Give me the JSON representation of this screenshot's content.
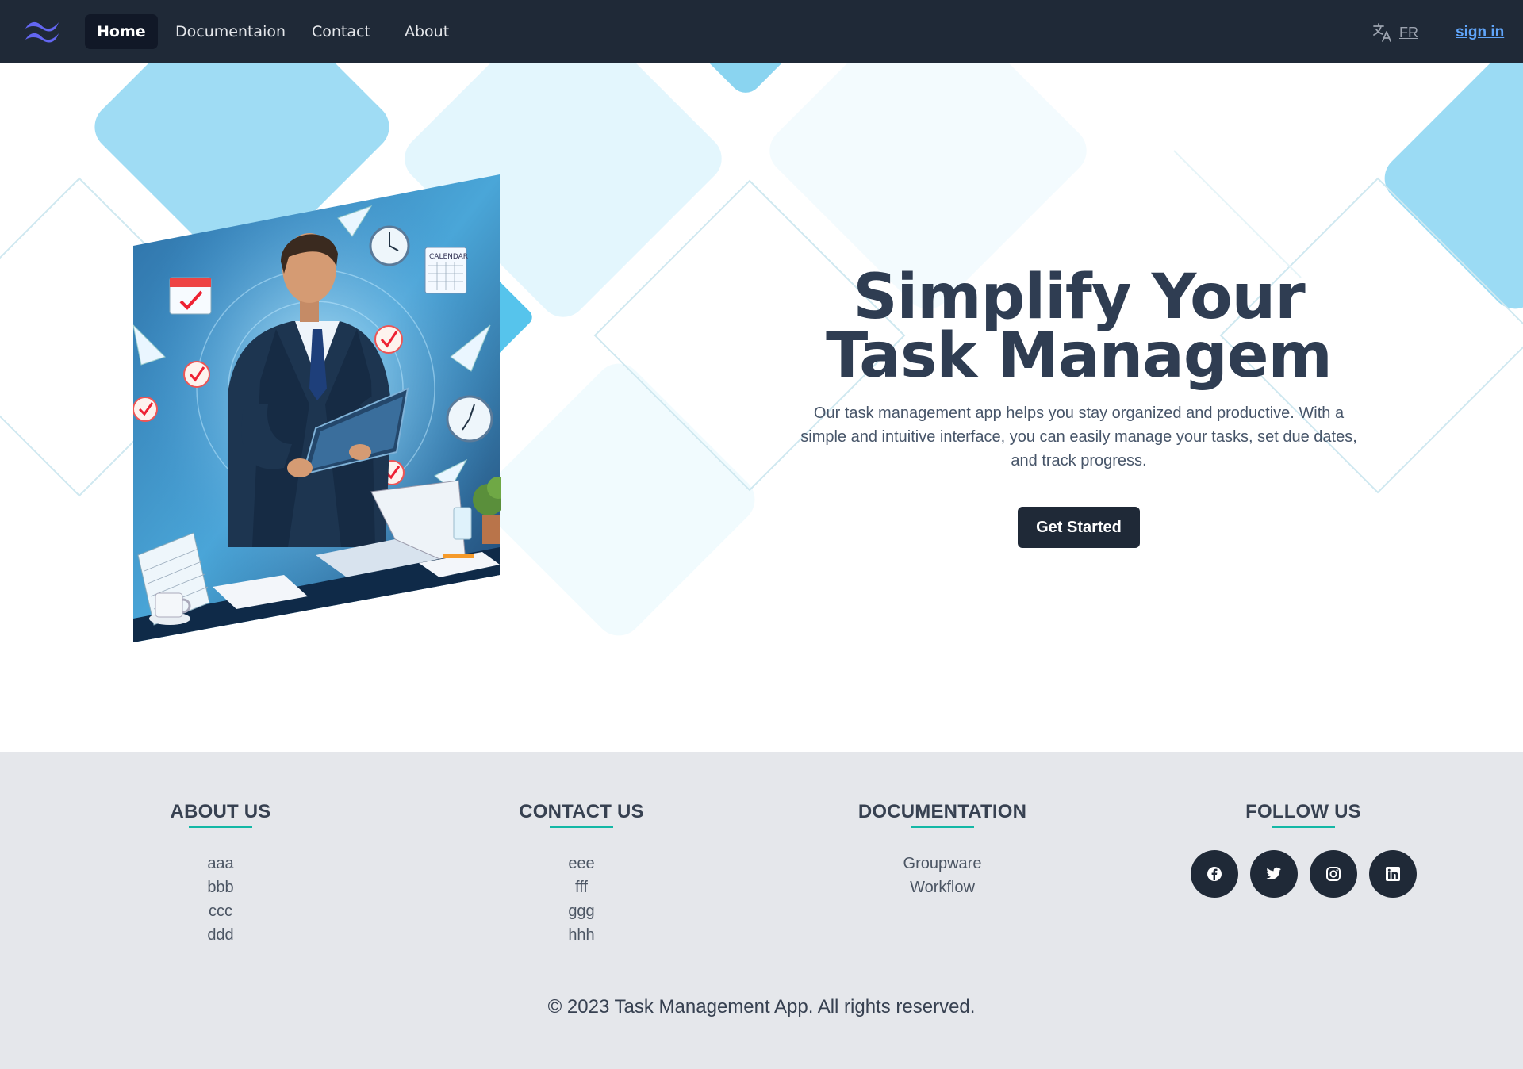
{
  "nav": {
    "items": [
      {
        "label": "Home",
        "active": true
      },
      {
        "label": "Documentaion",
        "active": false
      },
      {
        "label": "Contact",
        "active": false
      },
      {
        "label": "About",
        "active": false
      }
    ],
    "language": "FR",
    "sign_in": "sign in",
    "logo_icon": "wave-logo-icon",
    "translate_icon": "translate-icon"
  },
  "hero": {
    "title": "Simplify Your Task Managem",
    "description": "Our task management app helps you stay organized and productive. With a simple and intuitive interface, you can easily manage your tasks, set due dates, and track progress.",
    "cta_label": "Get Started",
    "illustration_calendar_label": "CALENDAR"
  },
  "footer": {
    "columns": [
      {
        "heading": "ABOUT US",
        "items": [
          "aaa",
          "bbb",
          "ccc",
          "ddd"
        ]
      },
      {
        "heading": "CONTACT US",
        "items": [
          "eee",
          "fff",
          "ggg",
          "hhh"
        ]
      },
      {
        "heading": "DOCUMENTATION",
        "items": [
          "Groupware",
          "Workflow"
        ]
      },
      {
        "heading": "FOLLOW US",
        "social": [
          "facebook-icon",
          "twitter-icon",
          "instagram-icon",
          "linkedin-icon"
        ]
      }
    ],
    "copyright": "© 2023 Task Management App. All rights reserved."
  },
  "colors": {
    "nav_bg": "#1f2937",
    "accent_link": "#60a5fa",
    "underline_accent": "#14b8a6",
    "footer_bg": "#e5e7eb",
    "logo": "#6366f1"
  }
}
